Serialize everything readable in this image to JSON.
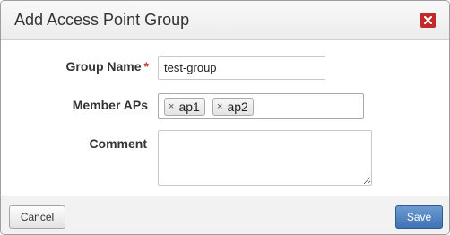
{
  "dialog": {
    "title": "Add Access Point Group",
    "close_icon": "close-icon",
    "accent_close": "#c22a2a"
  },
  "form": {
    "group_name_label": "Group Name",
    "required_mark": "*",
    "group_name_value": "test-group",
    "member_aps_label": "Member APs",
    "member_aps": [
      "ap1",
      "ap2"
    ],
    "tag_remove_symbol": "×",
    "comment_label": "Comment",
    "comment_value": ""
  },
  "footer": {
    "cancel_label": "Cancel",
    "save_label": "Save",
    "save_color": "#4a7cc0"
  }
}
